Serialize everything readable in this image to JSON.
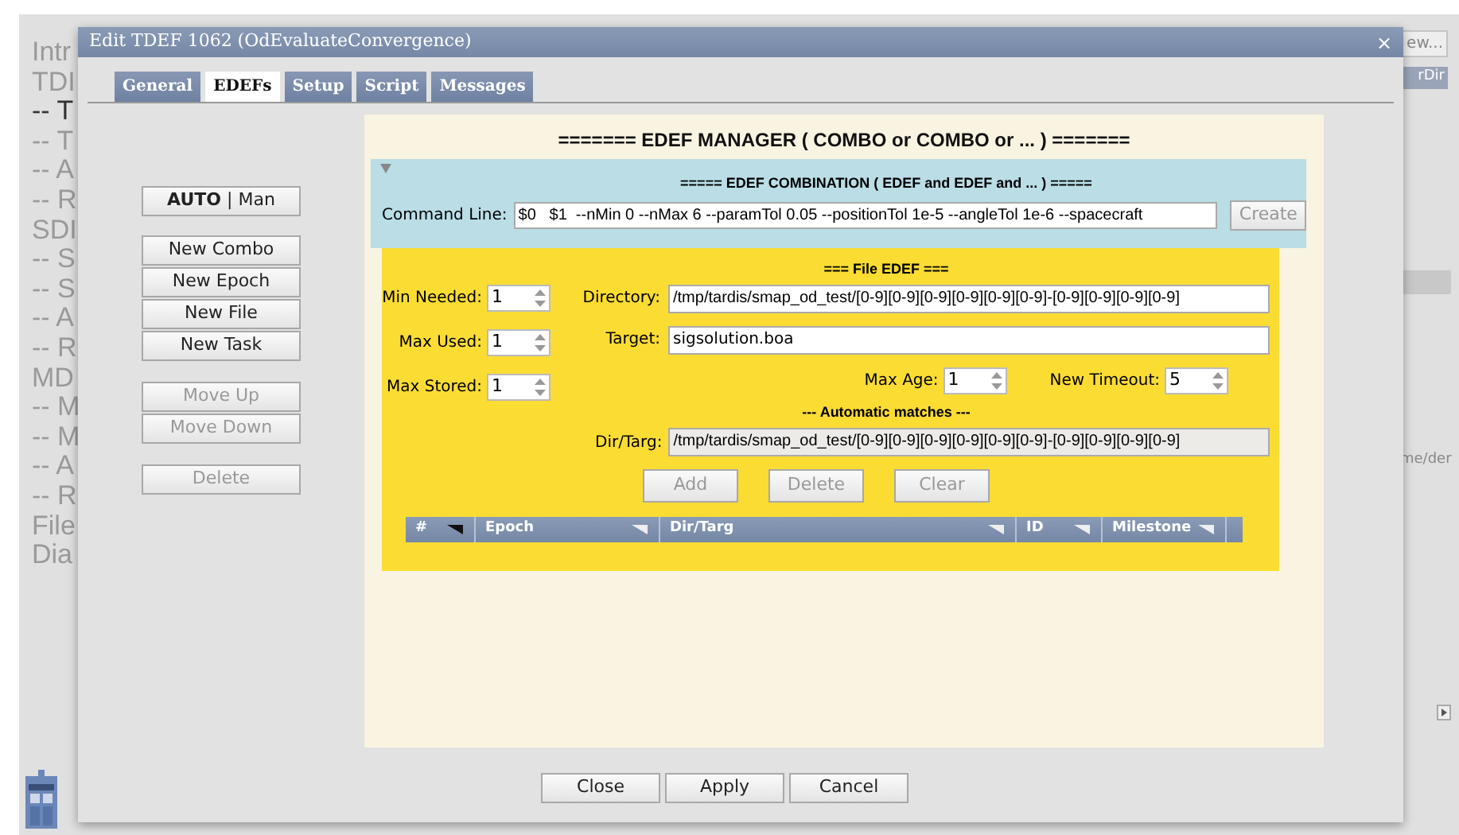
{
  "background": {
    "outline": [
      {
        "label": "Intr",
        "selected": false
      },
      {
        "label": "TDI",
        "selected": false
      },
      {
        "label": "-- T",
        "selected": true
      },
      {
        "label": "-- T",
        "selected": false
      },
      {
        "label": "-- A",
        "selected": false
      },
      {
        "label": "-- R",
        "selected": false
      },
      {
        "label": "SDI",
        "selected": false
      },
      {
        "label": "-- S",
        "selected": false
      },
      {
        "label": "-- S",
        "selected": false
      },
      {
        "label": "-- A",
        "selected": false
      },
      {
        "label": "-- R",
        "selected": false
      },
      {
        "label": "MD",
        "selected": false
      },
      {
        "label": "-- M",
        "selected": false
      },
      {
        "label": "-- M",
        "selected": false
      },
      {
        "label": "-- A",
        "selected": false
      },
      {
        "label": "-- R",
        "selected": false
      },
      {
        "label": "File",
        "selected": false
      },
      {
        "label": "Dia",
        "selected": false
      }
    ],
    "right_button": "ew...",
    "right_header": "rDir",
    "right_cell": "me/der"
  },
  "dialog": {
    "title": "Edit TDEF 1062 (OdEvaluateConvergence)",
    "close": "×",
    "tabs": [
      {
        "label": "General",
        "selected": false
      },
      {
        "label": "EDEFs",
        "selected": true
      },
      {
        "label": "Setup",
        "selected": false
      },
      {
        "label": "Script",
        "selected": false
      },
      {
        "label": "Messages",
        "selected": false
      }
    ],
    "mode": {
      "auto": "AUTO",
      "separator": "|",
      "manual": "Man"
    },
    "side_button_groups": [
      [
        {
          "label": "New Combo",
          "disabled": false
        },
        {
          "label": "New Epoch",
          "disabled": false
        },
        {
          "label": "New File",
          "disabled": false
        },
        {
          "label": "New Task",
          "disabled": false
        }
      ],
      [
        {
          "label": "Move Up",
          "disabled": true
        },
        {
          "label": "Move Down",
          "disabled": true
        }
      ],
      [
        {
          "label": "Delete",
          "disabled": true
        }
      ]
    ],
    "manager_title": "======= EDEF MANAGER ( COMBO or COMBO or ... ) =======",
    "combination": {
      "title": "===== EDEF COMBINATION ( EDEF and EDEF and ... ) =====",
      "expanded": true,
      "command_label": "Command Line:",
      "command_value": "$0   $1  --nMin 0 --nMax 6 --paramTol 0.05 --positionTol 1e-5 --angleTol 1e-6 --spacecraft",
      "create": "Create",
      "create_disabled": true
    },
    "file_edef": {
      "title": "=== File EDEF ===",
      "spinners": [
        {
          "label": "Min Needed:",
          "value": "1"
        },
        {
          "label": "Max Used:",
          "value": "1"
        },
        {
          "label": "Max Stored:",
          "value": "1"
        }
      ],
      "directory_label": "Directory:",
      "directory": "/tmp/tardis/smap_od_test/[0-9][0-9][0-9][0-9][0-9][0-9]-[0-9][0-9][0-9][0-9]",
      "target_label": "Target:",
      "target": "sigsolution.boa",
      "max_age": {
        "label": "Max Age:",
        "value": "1"
      },
      "new_timeout": {
        "label": "New Timeout:",
        "value": "5"
      },
      "auto_title": "--- Automatic matches ---",
      "dirtarg_label": "Dir/Targ:",
      "dirtarg": "/tmp/tardis/smap_od_test/[0-9][0-9][0-9][0-9][0-9][0-9]-[0-9][0-9][0-9][0-9]",
      "actions": [
        {
          "label": "Add",
          "disabled": true
        },
        {
          "label": "Delete",
          "disabled": true
        },
        {
          "label": "Clear",
          "disabled": true
        }
      ],
      "columns": [
        {
          "label": "#",
          "sorted": true
        },
        {
          "label": "Epoch",
          "sorted": false
        },
        {
          "label": "Dir/Targ",
          "sorted": false
        },
        {
          "label": "ID",
          "sorted": false
        },
        {
          "label": "Milestone",
          "sorted": false
        }
      ]
    },
    "footer": [
      "Close",
      "Apply",
      "Cancel"
    ]
  }
}
